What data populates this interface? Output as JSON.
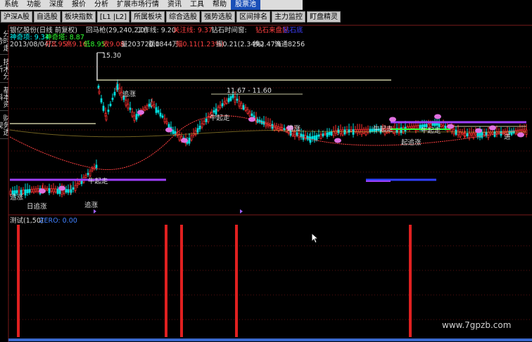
{
  "menubar": {
    "items": [
      "系统",
      "功能",
      "深度",
      "报价",
      "分析",
      "扩展市场行情",
      "资讯",
      "工具",
      "帮助",
      "股票池"
    ]
  },
  "toolbar": {
    "buttons": [
      "沪深A股",
      "自选股",
      "板块指数",
      "[L1 |L2]",
      "所属板块",
      "综合选股",
      "强势选股",
      "区间排名",
      "主力监控",
      "盯盘精灵"
    ]
  },
  "side_tabs": [
    "分时走势",
    "技术分析",
    "基本资料",
    "财务透视"
  ],
  "stock_header": {
    "title": "银亿股份(日线 前复权)",
    "indicator_label": "回马枪(29,240,2,0)",
    "work_line": "工作线: 9.20",
    "attention_line": "关注线: 9.37",
    "diamond_time": "钻石时间窗:",
    "diamond_tags": [
      "钻石来盘区",
      "钻石底"
    ],
    "god_line_a": "神奇项: 9.34",
    "god_line_b": "神奇塔: 8.87",
    "date": "2013/08/04/二",
    "open": "开8.95",
    "high": "高9.16",
    "low": "低8.95",
    "close": "收9.08",
    "volume": "量203720.0",
    "amount": "额1844万",
    "change": "幅0.11(1.23%)",
    "amplitude": "振0.21(2.34%)",
    "turnover": "换2.47%",
    "circulation": "流通8256"
  },
  "annotations": {
    "high_price": "15.30",
    "range_label": "11.67 - 11.60",
    "signal_labels": [
      "追涨",
      "牛起走",
      "追涨",
      "牛起走",
      "牛起走",
      "牛起走",
      "日追涨",
      "追涨",
      "起追涨",
      "追涨",
      "进"
    ]
  },
  "lower_panel": {
    "title": "测试(1,50)",
    "zero_label": "ZERO: 0.00"
  },
  "watermark": "www.7gpzb.com",
  "colors": {
    "background": "#000000",
    "up": "#ff3030",
    "down": "#00ffff",
    "accent_blue": "#1a4fb8",
    "signal_red": "#e02020",
    "purple_line": "#a040ff"
  }
}
